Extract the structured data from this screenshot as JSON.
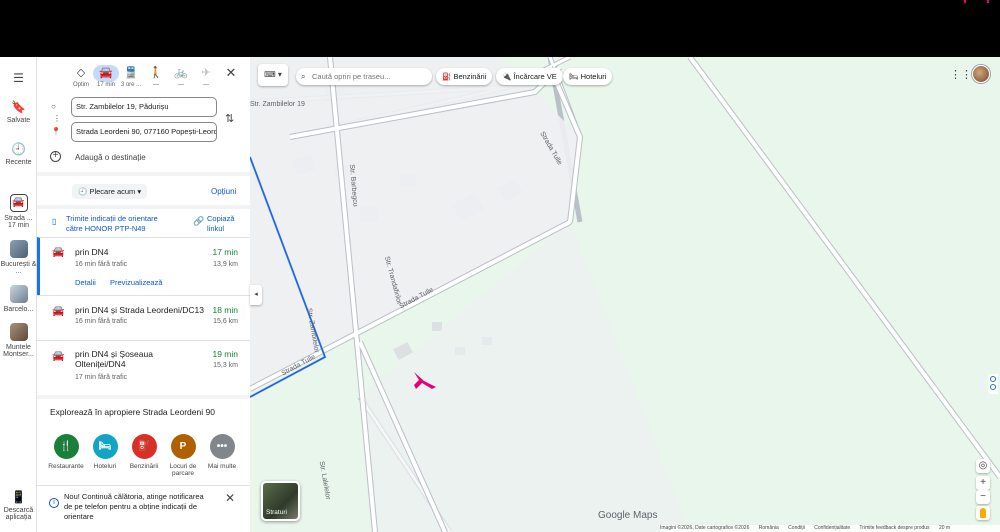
{
  "modes": [
    {
      "icon": "◇",
      "label": "Optim"
    },
    {
      "icon": "🚘",
      "label": "17 min"
    },
    {
      "icon": "🚆",
      "label": "3 ore ..."
    },
    {
      "icon": "🚶",
      "label": "—"
    },
    {
      "icon": "🚲",
      "label": "—"
    },
    {
      "icon": "✈",
      "label": "—"
    }
  ],
  "origin": "Str. Zambilelor 19, Pădurișu",
  "destination": "Strada Leordeni 90, 077160 Popești-Leordeni",
  "add_destination": "Adaugă o destinație",
  "depart_label": "Plecare acum",
  "options_label": "Opțiuni",
  "send_label": "Trimite indicații de orientare către HONOR PTP-N49",
  "copy_label": "Copiază linkul",
  "routes": [
    {
      "name": "prin DN4",
      "sub": "16 min fără trafic",
      "time": "17 min",
      "dist": "13,9 km",
      "details": "Detalii",
      "preview": "Previzualizează"
    },
    {
      "name": "prin DN4 și Strada Leordeni/DC13",
      "sub": "16 min fără trafic",
      "time": "18 min",
      "dist": "15,6 km"
    },
    {
      "name": "prin DN4 și Șoseaua Olteniței/DN4",
      "sub": "17 min fără trafic",
      "time": "19 min",
      "dist": "15,3 km"
    }
  ],
  "explore_title": "Explorează în apropiere Strada Leordeni 90",
  "categories": [
    {
      "label": "Restaurante",
      "icon": "🍴",
      "color": "#188038"
    },
    {
      "label": "Hoteluri",
      "icon": "🛏",
      "color": "#12a4c4"
    },
    {
      "label": "Benzinării",
      "icon": "⛽",
      "color": "#d93025"
    },
    {
      "label": "Locuri de parcare",
      "icon": "P",
      "color": "#b06000"
    },
    {
      "label": "Mai multe",
      "icon": "•••",
      "color": "#80868b"
    }
  ],
  "notice": "Nou! Continuă călătoria, atinge notificarea de pe telefon pentru a obține indicații de orientare",
  "rail": [
    {
      "icon": "☰",
      "label": ""
    },
    {
      "icon": "🔖",
      "label": "Salvate"
    },
    {
      "icon": "🕘",
      "label": "Recente"
    },
    {
      "label": "Strada ...\n17 min"
    },
    {
      "label": "București & ..."
    },
    {
      "label": "Barcelo..."
    },
    {
      "label": "Muntele Montser..."
    },
    {
      "icon": "📱",
      "label": "Descarcă aplicația"
    }
  ],
  "map": {
    "search_placeholder": "Caută opriri pe traseu...",
    "chips": [
      "Benzinării",
      "Încărcare VE",
      "Hoteluri"
    ],
    "layers_label": "Straturi",
    "brand": "Google Maps",
    "footer": [
      "Imagini ©2026, Date cartografice ©2026",
      "România",
      "Condiții",
      "Confidențialitate",
      "Trimite feedback despre produs",
      "20 m"
    ],
    "road_labels": [
      "Str. Zambilelor 19",
      "Strada Tulle",
      "Strada Tulle",
      "Strada Tulle",
      "Strada Tulle",
      "Str. Zambilelor",
      "Str. Barbegcu",
      "Str. Trandafirilor",
      "Str. Lalelelor"
    ]
  },
  "icons": {
    "close": "close-icon",
    "swap": "swap-icon",
    "search": "search-icon",
    "apps": "apps-grid-icon"
  }
}
